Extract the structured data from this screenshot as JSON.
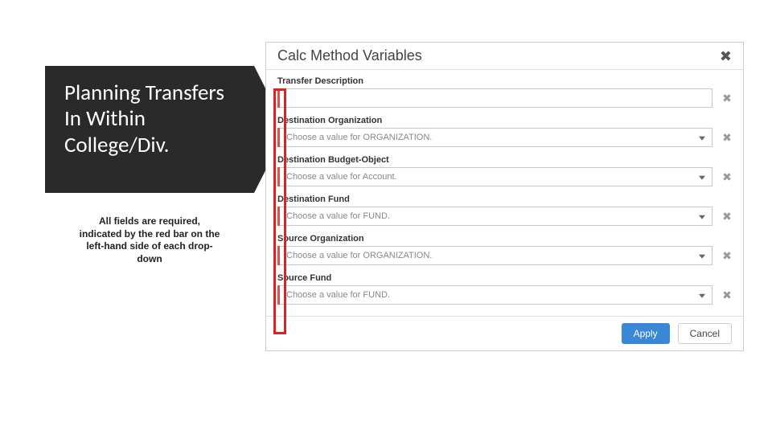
{
  "left_block": {
    "title": "Planning Transfers In Within College/Div.",
    "caption": "All fields are required, indicated by the red bar on the left-hand side of each drop-down"
  },
  "modal": {
    "title": "Calc Method Variables",
    "fields": [
      {
        "label": "Transfer Description",
        "placeholder": "",
        "has_caret": false
      },
      {
        "label": "Destination Organization",
        "placeholder": "Choose a value for ORGANIZATION.",
        "has_caret": true
      },
      {
        "label": "Destination Budget-Object",
        "placeholder": "Choose a value for Account.",
        "has_caret": true
      },
      {
        "label": "Destination Fund",
        "placeholder": "Choose a value for FUND.",
        "has_caret": true
      },
      {
        "label": "Source Organization",
        "placeholder": "Choose a value for ORGANIZATION.",
        "has_caret": true
      },
      {
        "label": "Source Fund",
        "placeholder": "Choose a value for FUND.",
        "has_caret": true
      }
    ],
    "buttons": {
      "apply": "Apply",
      "cancel": "Cancel"
    }
  }
}
